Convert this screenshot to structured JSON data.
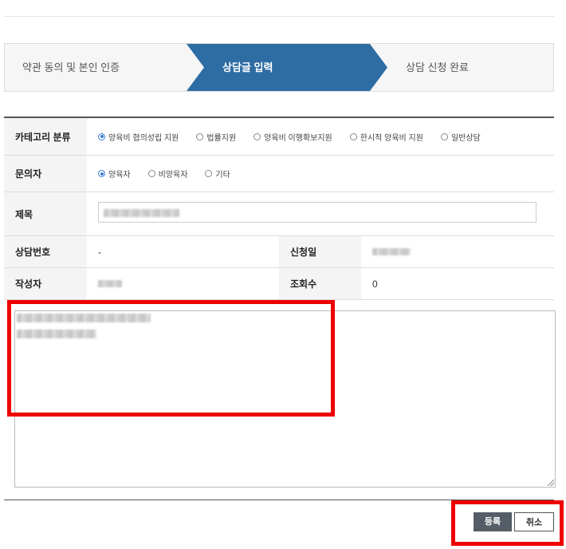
{
  "steps": [
    {
      "label": "약관 동의 및 본인 인증",
      "active": false
    },
    {
      "label": "상담글 입력",
      "active": true
    },
    {
      "label": "상담 신청 완료",
      "active": false
    }
  ],
  "colors": {
    "active_step": "#2e6ca4",
    "highlight": "#ee0000",
    "primary_button": "#555e67"
  },
  "form": {
    "category": {
      "label": "카테고리 분류",
      "options": [
        "양육비 협의성립 지원",
        "법률지원",
        "양육비 이행확보지원",
        "한시적 양육비 지원",
        "일반상담"
      ],
      "selected": "양육비 협의성립 지원"
    },
    "inquirer": {
      "label": "문의자",
      "options": [
        "양육자",
        "비양육자",
        "기타"
      ],
      "selected": "양육자"
    },
    "title": {
      "label": "제목"
    },
    "consult_no": {
      "label": "상담번호",
      "value": "-"
    },
    "request_date": {
      "label": "신청일"
    },
    "author": {
      "label": "작성자"
    },
    "views": {
      "label": "조회수",
      "value": "0"
    }
  },
  "buttons": {
    "register": "등록",
    "cancel": "취소"
  }
}
